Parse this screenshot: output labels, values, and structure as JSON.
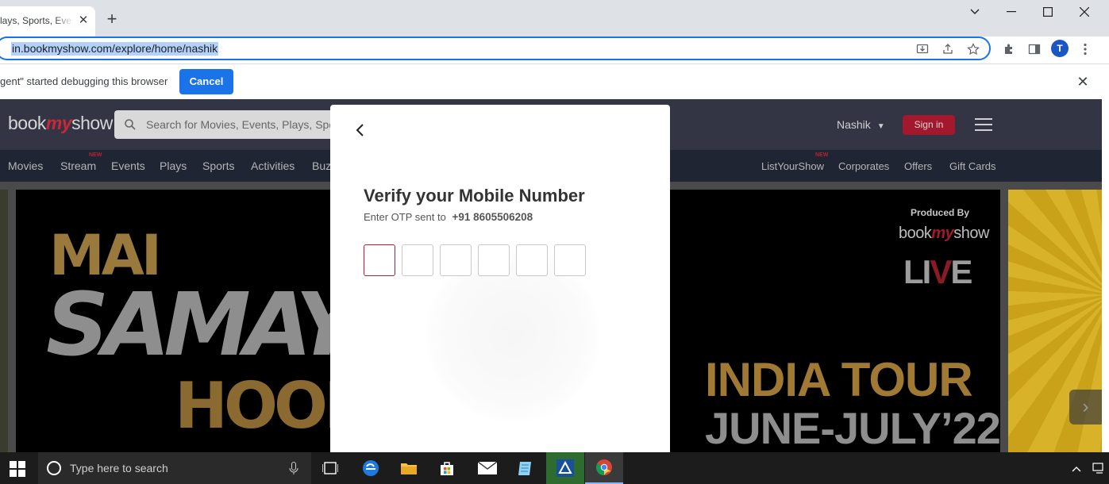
{
  "browser": {
    "tab_title": "lays, Sports, Even",
    "url": "in.bookmyshow.com/explore/home/nashik",
    "infobar_text": "gent\" started debugging this browser",
    "infobar_cancel": "Cancel",
    "profile_initial": "T"
  },
  "site": {
    "logo_part1": "book",
    "logo_part2": "my",
    "logo_part3": "show",
    "search_placeholder": "Search for Movies, Events, Plays, Sports and Activities",
    "city": "Nashik",
    "signin": "Sign in",
    "nav_left": [
      "Movies",
      "Stream",
      "Events",
      "Plays",
      "Sports",
      "Activities",
      "Buz"
    ],
    "nav_right": [
      "ListYourShow",
      "Corporates",
      "Offers",
      "Gift Cards"
    ],
    "new_badge": "NEW"
  },
  "banner": {
    "line1": "MAI",
    "line2": "SAMAY",
    "line3": "HOON",
    "produced_by": "Produced By",
    "live_l": "LI",
    "live_v": "V",
    "live_e": "E",
    "tour": "INDIA TOUR",
    "dates": "JUNE-JULY’22"
  },
  "modal": {
    "title": "Verify your Mobile Number",
    "subtitle": "Enter OTP sent to",
    "phone": "+91 8605506208",
    "otp_count": 6
  },
  "taskbar": {
    "search_placeholder": "Type here to search"
  },
  "colors": {
    "accent_blue": "#1a73e8",
    "brand_red": "#c9283a",
    "otp_active": "#b31e3c"
  }
}
